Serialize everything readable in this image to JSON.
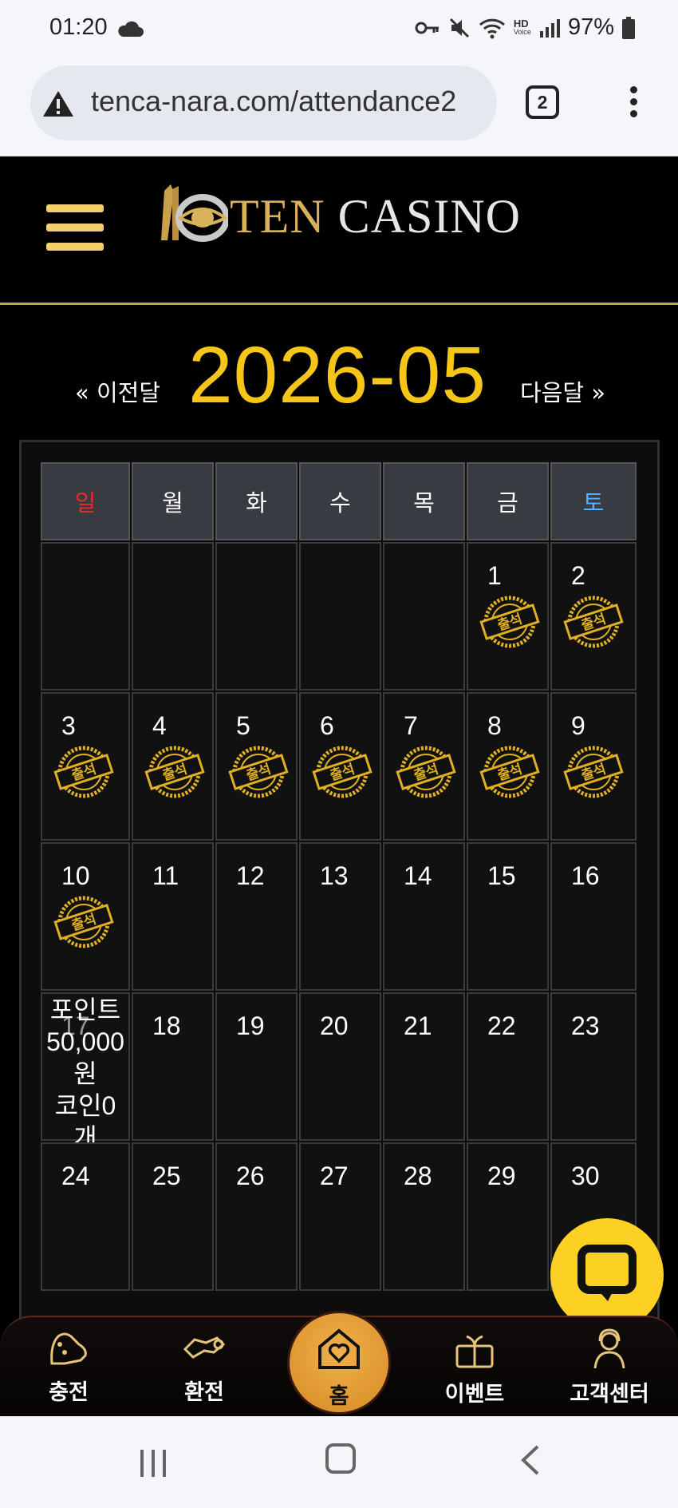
{
  "status_bar": {
    "time": "01:20",
    "battery": "97%",
    "hd_label": "HD",
    "voice_label": "Voice"
  },
  "browser": {
    "url": "tenca-nara.com/attendance2",
    "tab_count": "2"
  },
  "site": {
    "logo_ten": "TEN",
    "logo_casino": "CASINO"
  },
  "month_nav": {
    "prev_label": "« 이전달",
    "title": "2026-05",
    "next_label": "다음달 »"
  },
  "calendar": {
    "weekdays": [
      "일",
      "월",
      "화",
      "수",
      "목",
      "금",
      "토"
    ],
    "stamp_label": "출석",
    "weeks": [
      [
        "",
        "",
        "",
        "",
        "",
        "1",
        "2"
      ],
      [
        "3",
        "4",
        "5",
        "6",
        "7",
        "8",
        "9"
      ],
      [
        "10",
        "11",
        "12",
        "13",
        "14",
        "15",
        "16"
      ],
      [
        "17",
        "18",
        "19",
        "20",
        "21",
        "22",
        "23"
      ],
      [
        "24",
        "25",
        "26",
        "27",
        "28",
        "29",
        "30"
      ]
    ],
    "attended": [
      "1",
      "2",
      "3",
      "4",
      "5",
      "6",
      "7",
      "8",
      "9",
      "10"
    ],
    "points_text": "포인트 50,000원 코인0개",
    "points_line1": "포인트",
    "points_line2": "50,000",
    "points_line3": "원",
    "points_line4": "코인0",
    "points_line5": "개"
  },
  "bottom_nav": {
    "deposit": "충전",
    "withdraw": "환전",
    "home": "홈",
    "events": "이벤트",
    "support": "고객센터"
  },
  "colors": {
    "gold": "#f5c518",
    "accent_gold": "#c9a14a",
    "chat_yellow": "#fdd024",
    "sunday": "#e52b2b",
    "saturday": "#5ab0ff"
  }
}
